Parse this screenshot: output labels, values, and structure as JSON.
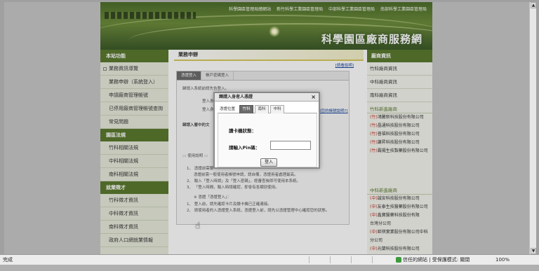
{
  "banner": {
    "topnav": [
      "科學園區管理局總網站",
      "新竹科學工業園區管理局",
      "中部科學工業園區管理局",
      "南部科學工業園區管理局"
    ],
    "site_name": "科學園區廠商服務網"
  },
  "left": {
    "head1": "本站功能",
    "items1": [
      "業務資訊導覽",
      "業務申辦（系統登入）",
      "申請廠商管理帳號",
      "已停用廠商管理帳號查詢",
      "常見問題"
    ],
    "head2": "園區法規",
    "items2": [
      "竹科相關法規",
      "中科相關法規",
      "南科相關法規"
    ],
    "head3": "就業徵才",
    "items3": [
      "竹科徵才資訊",
      "中科徵才資訊",
      "南科徵才資訊",
      "政府人口網就業情報"
    ]
  },
  "main": {
    "title": "業務申辦",
    "help_link": "[請看說明]",
    "tabs": [
      "憑證登入",
      "帳戶密碼登入"
    ],
    "line1": "歸請入系統前請先告登入。",
    "field1": "登入身",
    "field2": "登入身",
    "link_right": "憑您的帳號說明?]",
    "line2": "歸請入層中的文",
    "notes_head": "::: 使用說明 :::",
    "notes": [
      "1、 憑證前需要",
      "憑證前需一般使用者帳號申請，請自備，憑證用者處理最高。",
      "2、 輸入「登入時請」及「登入密碼」，經審查後即可使用本系統。",
      "3、 「登入時間，輸入時請確認，即會有各類別使用。",
      "※ 憑證「憑證登入」：",
      "1、 登入前，請先確認卡片及讀卡機已正確連接。",
      "2、 請使用者的入憑證登入系統，憑證登入前，請先以憑證管理中心確認您的狀態。"
    ]
  },
  "modal": {
    "title": "歸請入身者人憑證",
    "close": "×",
    "cert_label": "憑證位置",
    "tabs": [
      "竹科",
      "南科",
      "中科"
    ],
    "status_label": "讀卡機狀態：",
    "pin_label": "請輸入Pin碼：",
    "pin_value": "",
    "login_button": "登入"
  },
  "right": {
    "head": "廠商資訊",
    "items": [
      "竹科廠商資訊",
      "中科廠商資訊",
      "南科廠商資訊"
    ],
    "new_head1": "竹科新進廠商",
    "new1": [
      {
        "tag": "(竹)",
        "name": "鴻騰新科技股份有限公司"
      },
      {
        "tag": "(竹)",
        "name": "晶通科技股份有限公司"
      },
      {
        "tag": "(竹)",
        "name": "普福科技股份有限公司"
      },
      {
        "tag": "(竹)",
        "name": "謙昇科技股份有限公司"
      },
      {
        "tag": "(竹)",
        "name": "霸揚生技製藥股份有限公司"
      }
    ],
    "new_head2": "中科新進廠商",
    "new2": [
      {
        "tag": "(中)",
        "name": "誠安科技股份有限公司"
      },
      {
        "tag": "(中)",
        "name": "友泰生技醫藥股份有限公司"
      },
      {
        "tag": "(中)",
        "name": "鑫寶醫藥科技股份有限"
      },
      {
        "tag": "",
        "name": "台灣分公司"
      },
      {
        "tag": "(中)",
        "name": "鉅祺實業股份有限公司中科"
      },
      {
        "tag": "",
        "name": "分公司"
      },
      {
        "tag": "(中)",
        "name": "光蘭科技股份有限公司"
      }
    ]
  },
  "statusbar": {
    "left": "完成",
    "zone": "信任的網站 | 受保護模式: 關閉",
    "zoom": "100%"
  }
}
